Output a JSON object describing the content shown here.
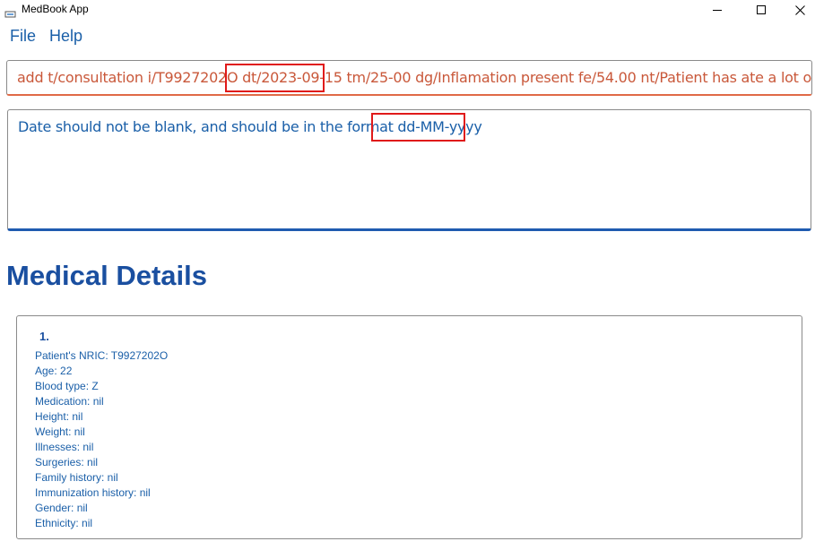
{
  "window": {
    "title": "MedBook App",
    "icons": {
      "app": "app-icon",
      "minimize": "minimize-icon",
      "maximize": "maximize-icon",
      "close": "close-icon"
    }
  },
  "menu": {
    "file_label": "File",
    "help_label": "Help"
  },
  "command": {
    "value": "add t/consultation i/T9927202O dt/2023-09-15 tm/25-00 dg/Inflamation present fe/54.00 nt/Patient has ate a lot of unhe",
    "error_color": "#c9583a"
  },
  "result": {
    "message": "Date should not be blank, and should be in the format dd-MM-yyyy"
  },
  "section": {
    "title": "Medical Details"
  },
  "record": {
    "index": "1.",
    "details": [
      "Patient's NRIC: T9927202O",
      "Age: 22",
      "Blood type: Z",
      "Medication: nil",
      "Height: nil",
      "Weight: nil",
      "Illnesses: nil",
      "Surgeries: nil",
      "Family history: nil",
      "Immunization history: nil",
      "Gender: nil",
      "Ethnicity: nil"
    ]
  },
  "colors": {
    "accent": "#1a5fa8",
    "heading": "#1a4fa0",
    "highlight": "#e01a1a",
    "result_border": "#1f5bb0",
    "command_border": "#e06a47"
  }
}
